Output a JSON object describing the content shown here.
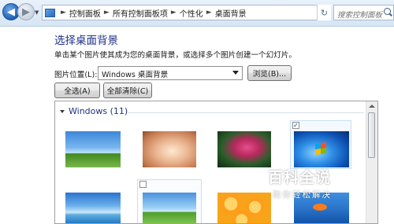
{
  "address_bar": {
    "crumbs": [
      "控制面板",
      "所有控制面板项",
      "个性化",
      "桌面背景"
    ],
    "search_placeholder": "搜索控制面板"
  },
  "page": {
    "title": "选择桌面背景",
    "description": "单击某个图片使其成为您的桌面背景，或选择多个图片创建一个幻灯片。"
  },
  "picture_location": {
    "label": "图片位置(L):",
    "selected": "Windows 桌面背景",
    "browse_label": "浏览(B)..."
  },
  "actions": {
    "select_all_label": "全选(A)",
    "clear_all_label": "全部清除(C)"
  },
  "gallery": {
    "group_label": "Windows (11)",
    "thumbnails": [
      {
        "name": "sky-flowers",
        "checked": false
      },
      {
        "name": "girl-portrait",
        "checked": false
      },
      {
        "name": "pink-leaf",
        "checked": false
      },
      {
        "name": "windows-logo-blue",
        "checked": true
      },
      {
        "name": "ocean-sky",
        "checked": false
      },
      {
        "name": "sky-flowers-2",
        "checked": false
      },
      {
        "name": "oranges",
        "checked": false
      },
      {
        "name": "blue-fish",
        "checked": false
      }
    ]
  },
  "watermark": {
    "main": "百科全说",
    "sub": "助你轻松解决"
  }
}
